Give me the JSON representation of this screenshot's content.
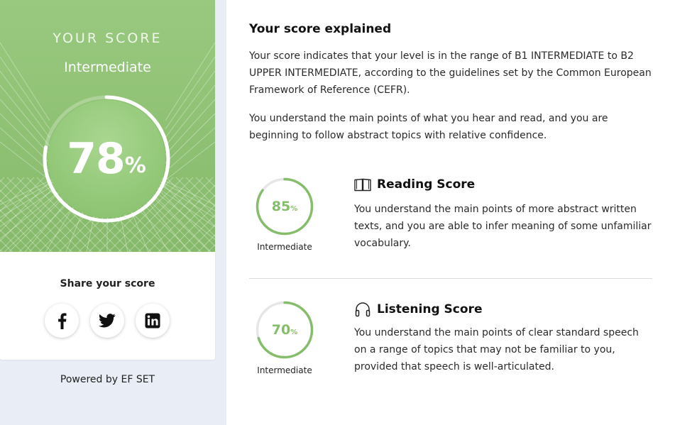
{
  "score_panel": {
    "title": "YOUR SCORE",
    "level": "Intermediate",
    "score_value": "78",
    "score_fraction": 0.78,
    "score_unit": "%",
    "share_title": "Share your score",
    "share_buttons": [
      {
        "name": "facebook",
        "icon": "facebook-icon"
      },
      {
        "name": "twitter",
        "icon": "twitter-icon"
      },
      {
        "name": "linkedin",
        "icon": "linkedin-icon"
      }
    ],
    "powered_by": "Powered by EF SET"
  },
  "explanation": {
    "title": "Your score explained",
    "paragraphs": [
      "Your score indicates that your level is in the range of B1 INTERMEDIATE to B2 UPPER INTERMEDIATE, according to the guidelines set by the Common European Framework of Reference (CEFR).",
      "You understand the main points of what you hear and read, and you are beginning to follow abstract topics with relative confidence."
    ]
  },
  "skills": [
    {
      "title": "Reading Score",
      "icon": "book-icon",
      "score_value": "85",
      "score_fraction": 0.85,
      "score_unit": "%",
      "level": "Intermediate",
      "description": "You understand the main points of more abstract written texts, and you are able to infer meaning of some unfamiliar vocabulary."
    },
    {
      "title": "Listening Score",
      "icon": "headphones-icon",
      "score_value": "70",
      "score_fraction": 0.7,
      "score_unit": "%",
      "level": "Intermediate",
      "description": "You understand the main points of clear standard speech on a range of topics that may not be familiar to you, provided that speech is well-articulated."
    }
  ],
  "colors": {
    "hero_green": "#8fc274",
    "ring_green": "#86bd6b",
    "page_bg": "#e9eef6"
  }
}
